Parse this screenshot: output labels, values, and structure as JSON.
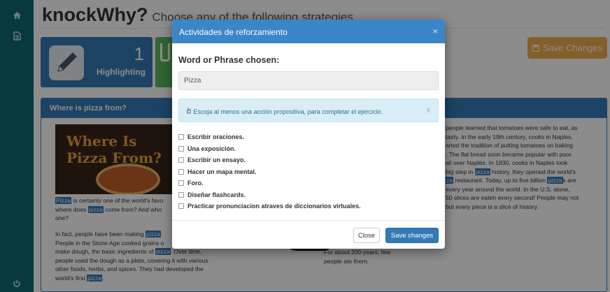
{
  "sidebar": {
    "icons": [
      "home-icon",
      "document-icon",
      "power-icon"
    ]
  },
  "header": {
    "title": "knockWhy?",
    "subtitle": "Choose any of the following strategies"
  },
  "strategy_card": {
    "number": "1",
    "label": "Highlighting",
    "icon": "pencil-icon"
  },
  "save_button_bg": {
    "label": "Save Changes",
    "icon": "floppy-icon",
    "color": "#f0ad4e"
  },
  "panel": {
    "heading": "Where is pizza from?",
    "image_text_line1": "Where Is",
    "image_text_line2": "Pizza From?",
    "col1_par1": [
      {
        "hl": "Pizza"
      },
      {
        "t": " is certainly one of the world's favo"
      },
      {
        "br": true
      },
      {
        "t": "where does "
      },
      {
        "hl": "pizza"
      },
      {
        "t": " come from? And who"
      },
      {
        "br": true
      },
      {
        "t": "one?"
      }
    ],
    "col1_par2": [
      {
        "t": "In fact, people have been making "
      },
      {
        "hl": "pizza"
      },
      {
        "br": true
      },
      {
        "t": "People in the Stone Age cooked grains o"
      },
      {
        "br": true
      },
      {
        "t": "make dough, the basic ingredients of "
      },
      {
        "hl": "pizza"
      },
      {
        "t": ". Over time,"
      },
      {
        "br": true
      },
      {
        "t": "people used the dough as a plate, covering it with various"
      },
      {
        "br": true
      },
      {
        "t": "other foods, herbs, and spices. They had developed the"
      },
      {
        "br": true
      },
      {
        "t": "world's first "
      },
      {
        "hl": "pizza"
      },
      {
        "t": "."
      }
    ],
    "col2_text": [
      {
        "t": "For about 200 years, few"
      },
      {
        "br": true
      },
      {
        "t": "people ate them."
      }
    ],
    "col3_text": [
      {
        "t": "people learned that tomatoes were safe to eat, as"
      },
      {
        "br": true
      },
      {
        "t": "tasty. In the early 19th century, cooks in Naples,"
      },
      {
        "br": true
      },
      {
        "t": "arted the tradition of putting tomatoes on baking"
      },
      {
        "br": true
      },
      {
        "t": ". The flat bread soon became popular with poor"
      },
      {
        "br": true
      },
      {
        "t": "all over Naples. In 1830, cooks in Naples took"
      },
      {
        "br": true
      },
      {
        "t": " big step in "
      },
      {
        "hl": "pizza"
      },
      {
        "t": " history, they opened the world's"
      },
      {
        "br": true
      },
      {
        "hl": "za"
      },
      {
        "t": " restaurant. Today, up to five billion "
      },
      {
        "hl": "pizza"
      },
      {
        "t": "s are"
      },
      {
        "br": true
      },
      {
        "t": "every year around the world. In the U.S. alone,"
      },
      {
        "br": true
      },
      {
        "t": "50 slices are eaten every second! People may not"
      },
      {
        "br": true
      },
      {
        "t": "but every piece is a slice of history."
      }
    ]
  },
  "modal": {
    "title": "Actividades de reforzamiento",
    "close_glyph": "×",
    "word_label": "Word or Phrase chosen:",
    "word_value": "Pizza",
    "alert_icon": "hand-pointer-icon",
    "alert_text": "Escoja al menos una acción propositiva, para completar el ejercicio.",
    "alert_close": "x",
    "options": [
      "Escribir oraciones.",
      "Una exposición.",
      "Escribir un ensayo.",
      "Hacer un mapa mental.",
      "Foro.",
      "Diseñar flashcards.",
      "Practicar pronunciacion atraves de diccionarios virtuales."
    ],
    "close_button": "Close",
    "save_button": "Save changes"
  }
}
